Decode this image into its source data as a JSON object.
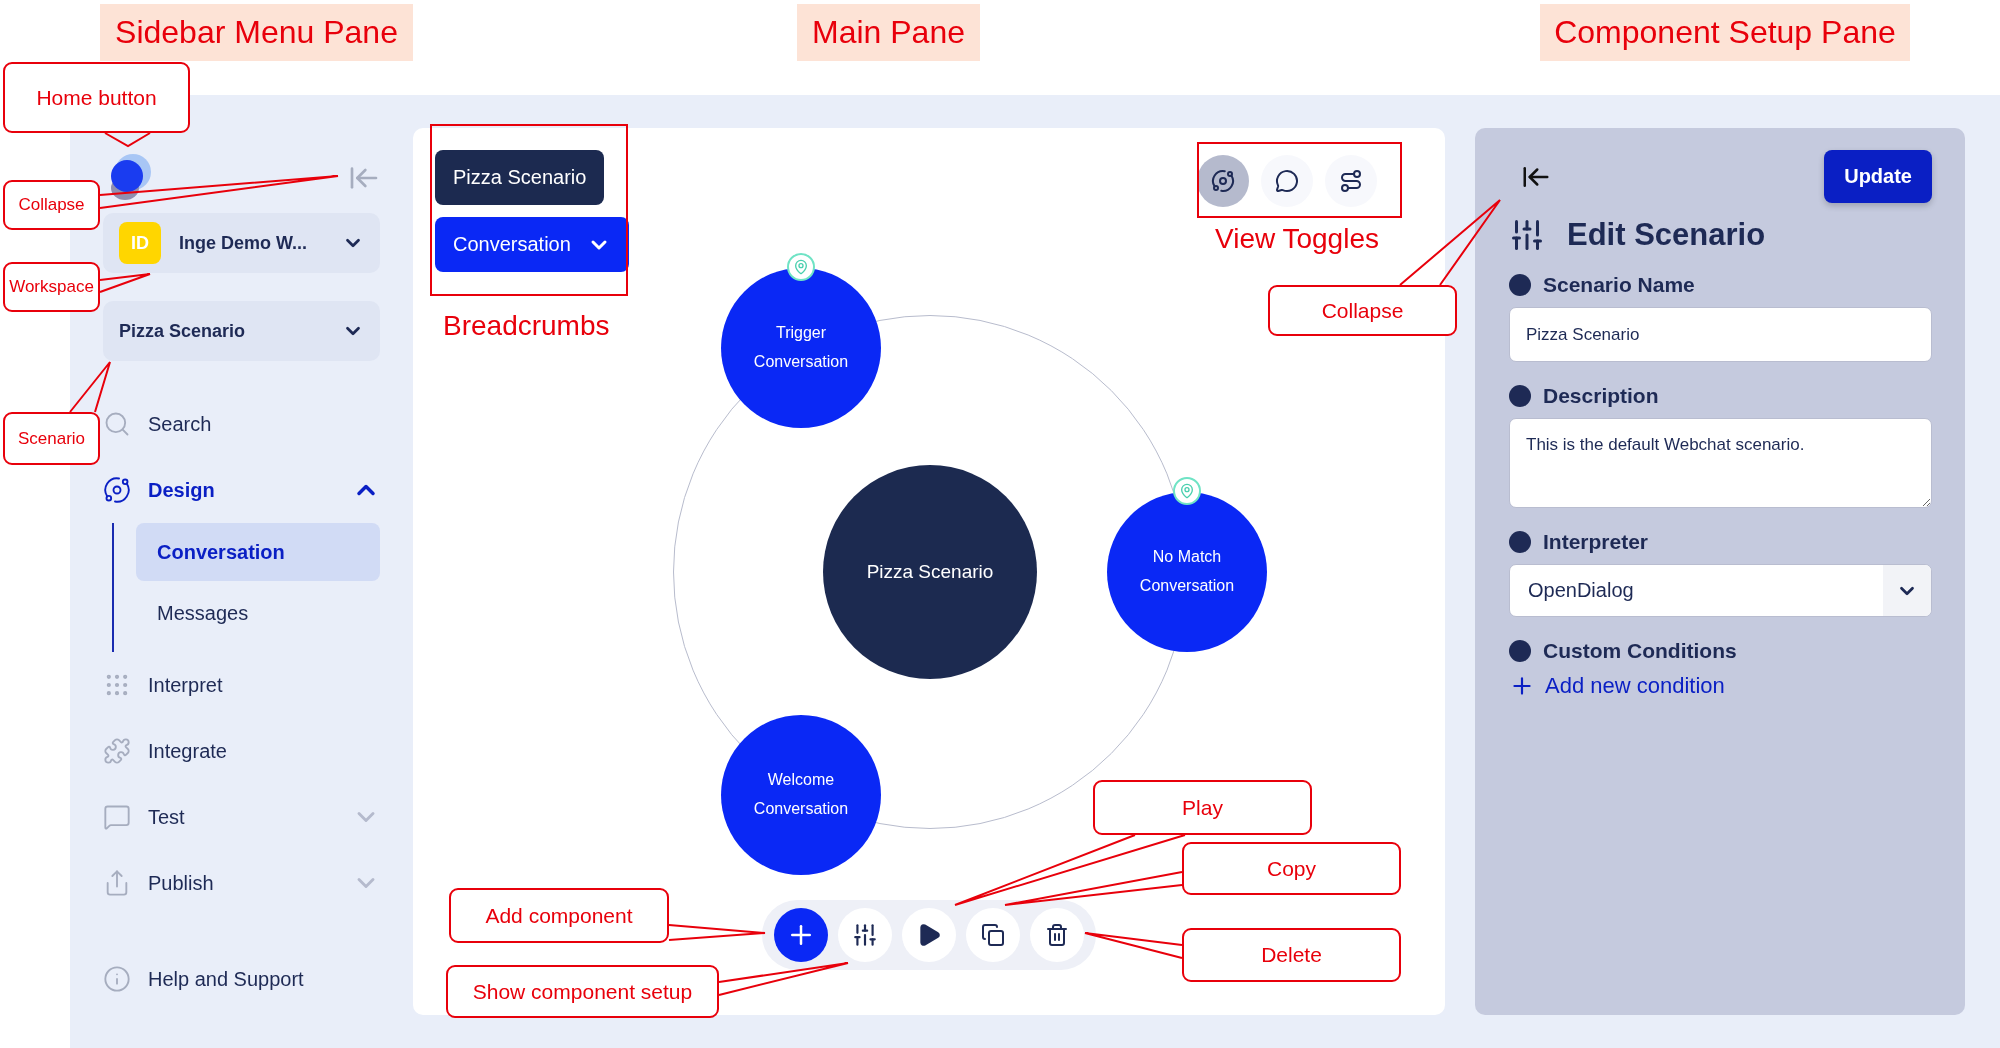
{
  "pane_labels": [
    "Sidebar Menu Pane",
    "Main Pane",
    "Component Setup Pane"
  ],
  "sidebar": {
    "workspace": {
      "badge": "ID",
      "name": "Inge Demo W..."
    },
    "scenario": "Pizza Scenario",
    "items": [
      {
        "label": "Search"
      },
      {
        "label": "Design",
        "expanded": true,
        "children": [
          {
            "label": "Conversation",
            "selected": true
          },
          {
            "label": "Messages",
            "selected": false
          }
        ]
      },
      {
        "label": "Interpret"
      },
      {
        "label": "Integrate"
      },
      {
        "label": "Test",
        "expanded": false
      },
      {
        "label": "Publish",
        "expanded": false
      },
      {
        "label": "Help and Support"
      }
    ]
  },
  "main": {
    "breadcrumbs": [
      {
        "label": "Pizza Scenario",
        "kind": "scenario"
      },
      {
        "label": "Conversation",
        "kind": "dropdown"
      }
    ],
    "view_toggles": [
      {
        "selected": true
      },
      {
        "selected": false
      },
      {
        "selected": false
      }
    ],
    "canvas": {
      "center": "Pizza Scenario",
      "nodes": [
        {
          "label": "Trigger Conversation",
          "pinned": true
        },
        {
          "label": "No Match Conversation",
          "pinned": true
        },
        {
          "label": "Welcome Conversation",
          "pinned": false
        }
      ]
    }
  },
  "setup": {
    "update": "Update",
    "title": "Edit Scenario",
    "fields": [
      {
        "label": "Scenario Name",
        "kind": "text",
        "value": "Pizza Scenario"
      },
      {
        "label": "Description",
        "kind": "textarea",
        "value": "This is the default Webchat scenario."
      },
      {
        "label": "Interpreter",
        "kind": "select",
        "value": "OpenDialog"
      },
      {
        "label": "Custom Conditions",
        "kind": "link",
        "value": "Add new condition"
      }
    ]
  },
  "annotations": [
    {
      "label": "Home button",
      "kind": "callout"
    },
    {
      "label": "Collapse",
      "kind": "callout"
    },
    {
      "label": "Workspace",
      "kind": "callout"
    },
    {
      "label": "Scenario",
      "kind": "callout"
    },
    {
      "label": "Breadcrumbs",
      "kind": "caption"
    },
    {
      "label": "View Toggles",
      "kind": "caption"
    },
    {
      "label": "Collapse",
      "kind": "callout"
    },
    {
      "label": "Play",
      "kind": "callout"
    },
    {
      "label": "Copy",
      "kind": "callout"
    },
    {
      "label": "Add component",
      "kind": "callout"
    },
    {
      "label": "Show component setup",
      "kind": "callout"
    },
    {
      "label": "Delete",
      "kind": "callout"
    }
  ]
}
